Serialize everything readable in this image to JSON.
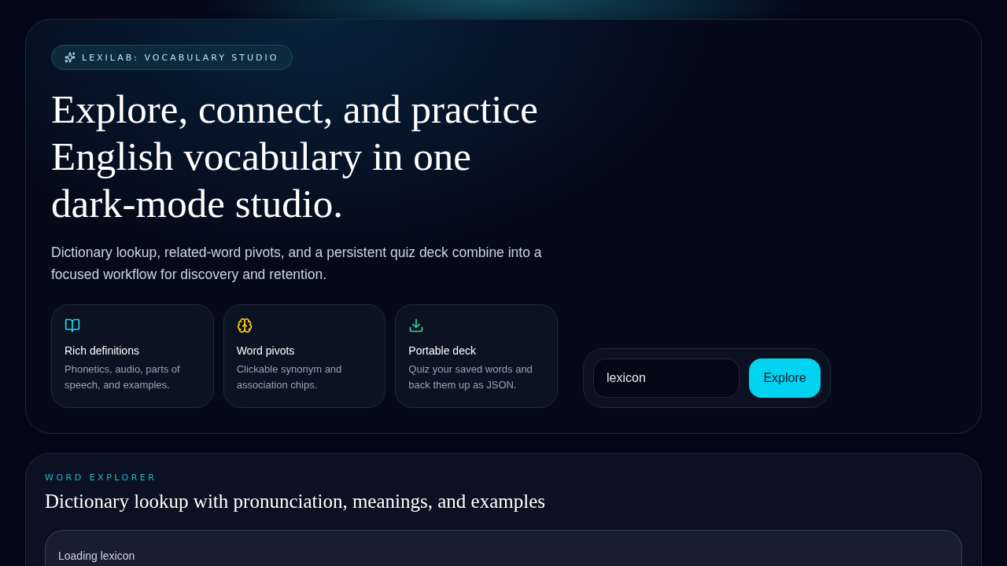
{
  "hero": {
    "badge": "LEXILAB: VOCABULARY STUDIO",
    "title": "Explore, connect, and practice English vocabulary in one dark-mode studio.",
    "subtitle": "Dictionary lookup, related-word pivots, and a persistent quiz deck combine into a focused workflow for discovery and retention.",
    "features": [
      {
        "kind": "book",
        "color": "#22d3ee",
        "title": "Rich definitions",
        "text": "Phonetics, audio, parts of speech, and examples."
      },
      {
        "kind": "brain",
        "color": "#facc15",
        "title": "Word pivots",
        "text": "Clickable synonym and association chips."
      },
      {
        "kind": "download",
        "color": "#34d399",
        "title": "Portable deck",
        "text": "Quiz your saved words and back them up as JSON."
      }
    ],
    "search": {
      "value": "lexicon",
      "button": "Explore"
    }
  },
  "explorer": {
    "eyebrow": "WORD EXPLORER",
    "title": "Dictionary lookup with pronunciation, meanings, and examples",
    "status": "Loading lexicon"
  }
}
